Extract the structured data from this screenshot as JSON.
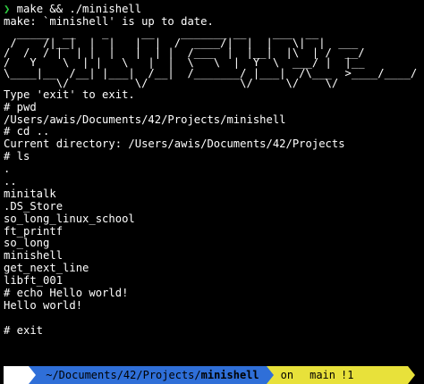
{
  "terminal": {
    "prompt_symbol": "❯",
    "command1": " make && ./minishell",
    "make_output": "make: `minishell' is up to date.",
    "banner_ascii": "  _____  __    _     __    _______ __    ___  __\n /    /|__|  |  |   |  |  /  ____/|  |  |   \\|  |  ___\n/  /  / |  | |  |   |  | |  /___  |  |__|  |\\  | /  __/\n/   Y    \\  | |   \\   |  |  \\   \\  |  Y  \\  ___/ |  |__\n\\____|__  /__| |___|  /__|  /_______/ |___|  /\\___  >____/____/\n        \\/          \\/              \\/     \\/    \\/",
    "lines": [
      "Type 'exit' to exit.",
      "# pwd",
      "/Users/awis/Documents/42/Projects/minishell",
      "# cd ..",
      "Current directory: /Users/awis/Documents/42/Projects",
      "# ls",
      ".",
      "..",
      "minitalk",
      ".DS_Store",
      "so_long_linux_school",
      "ft_printf",
      "so_long",
      "minishell",
      "get_next_line",
      "libft_001",
      "# echo Hello world!",
      "Hello world!",
      "",
      "# exit"
    ]
  },
  "statusbar": {
    "os_icon": "",
    "path_prefix": " ~/Documents/42/Projects/",
    "path_current": "minishell",
    "git_on": "on",
    "git_icon_1": "",
    "git_icon_2": "",
    "git_branch": "main",
    "git_status": "!1",
    "colors": {
      "os_segment": "#ffffff",
      "path_segment": "#2f6fd8",
      "git_segment": "#e8e13a",
      "prompt_arrow": "#2ecc40"
    }
  }
}
